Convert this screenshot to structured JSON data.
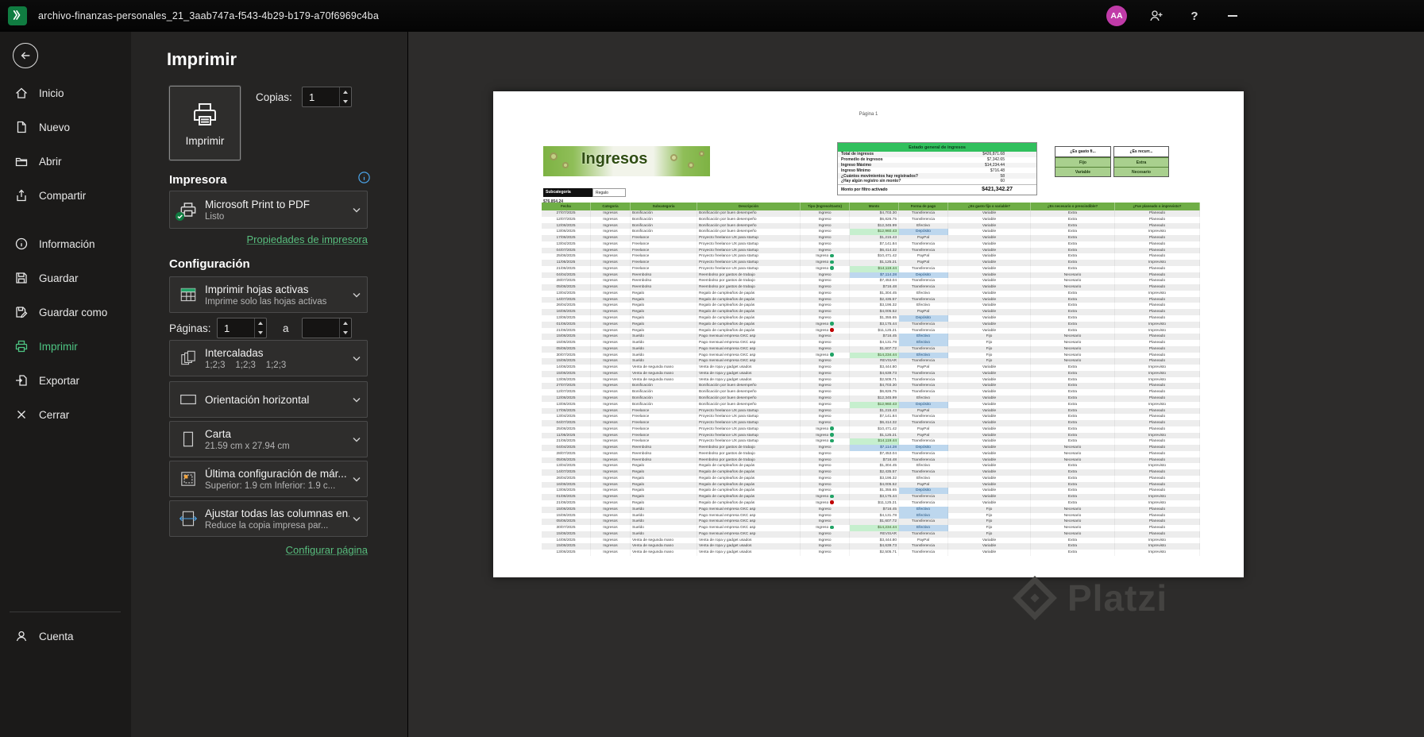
{
  "titlebar": {
    "title": "archivo-finanzas-personales_21_3aab747a-f543-4b29-b179-a70f6969c4ba",
    "avatar_initials": "AA"
  },
  "sidebar": {
    "items": [
      {
        "label": "Inicio"
      },
      {
        "label": "Nuevo"
      },
      {
        "label": "Abrir"
      },
      {
        "label": "Compartir"
      },
      {
        "label": "Información"
      },
      {
        "label": "Guardar"
      },
      {
        "label": "Guardar como"
      },
      {
        "label": "Imprimir",
        "active": true
      },
      {
        "label": "Exportar"
      },
      {
        "label": "Cerrar"
      },
      {
        "label": "Cuenta"
      }
    ]
  },
  "print_panel": {
    "title": "Imprimir",
    "print_button_label": "Imprimir",
    "copies_label": "Copias:",
    "copies_value": "1",
    "printer_section": "Impresora",
    "printer_name": "Microsoft Print to PDF",
    "printer_status": "Listo",
    "printer_props_link": "Propiedades de impresora",
    "settings_section": "Configuración",
    "pages_label": "Páginas:",
    "pages_from": "1",
    "pages_sep": "a",
    "pages_to": "",
    "dropdowns": [
      {
        "title": "Imprimir hojas activas",
        "subtitle": "Imprime solo las hojas activas"
      },
      {
        "title": "Intercaladas",
        "subtitle": "1;2;3    1;2;3    1;2;3"
      },
      {
        "title": "Orientación horizontal",
        "subtitle": ""
      },
      {
        "title": "Carta",
        "subtitle": "21.59 cm x 27.94 cm"
      },
      {
        "title": "Última configuración de már...",
        "subtitle": "Superior: 1.9 cm Inferior: 1.9 c..."
      },
      {
        "title": "Ajustar todas las columnas en...",
        "subtitle": "Reduce la copia impresa par..."
      }
    ],
    "page_setup_link": "Configurar página"
  },
  "preview": {
    "page_header": "Página 1",
    "banner_title": "Ingresos",
    "filter_label": "Subcategoría",
    "filter_value": "Regalo",
    "filter_amount": "$76,854.24",
    "summary": {
      "title": "Estado general de ingresos",
      "rows": [
        [
          "Total de ingresos",
          "$426,871.68"
        ],
        [
          "Promedio de ingresos",
          "$7,342.65"
        ],
        [
          "Ingreso Máximo",
          "$14,234.44"
        ],
        [
          "Ingreso Mínimo",
          "$716.48"
        ],
        [
          "¿Cuántos movimientos hay registrados?",
          "58"
        ],
        [
          "¿Hay algún registro sin monto?",
          "60"
        ]
      ],
      "total_label": "Monto por filtro activado",
      "total_value": "$421,342.27"
    },
    "mini_tables": [
      {
        "header": "¿Es gasto fi...",
        "rows": [
          "Fijo",
          "Variable"
        ]
      },
      {
        "header": "¿Es recurr...",
        "rows": [
          "Extra",
          "Necesario"
        ]
      }
    ],
    "table": {
      "headers": [
        "Fecha",
        "Categoría",
        "Subcategoría",
        "Descripción",
        "Tipo (Ingreso/Gasto)",
        "Monto",
        "Forma de pago",
        "¿Es gasto fijo o variable?",
        "¿Es necesario o prescindible?",
        "¿Fue planeado o imprevisto?"
      ],
      "categoria": "Ingresos",
      "tipo": "Ingreso",
      "subcat_desc": {
        "Bonificación": "Bonificación por buen desempeño",
        "Freelance": "Proyecto freelance UX para startup",
        "Reembolso": "Reembolso por gastos de trabajo",
        "Regalo": "Regalo de cumpleaños de papás",
        "Sueldo": "Pago mensual empresa GKC asp",
        "Venta de segunda mano": "Venta de ropa y gadget usados"
      },
      "rows": [
        [
          "27/07/2025",
          "Bonificación",
          "$4,703.30",
          "",
          "Transferencia",
          "",
          "Variable",
          "Extra",
          "Planeado",
          ""
        ],
        [
          "12/07/2025",
          "Bonificación",
          "$6,826.75",
          "",
          "Transferencia",
          "",
          "Variable",
          "Extra",
          "Planeado",
          ""
        ],
        [
          "12/06/2025",
          "Bonificación",
          "$12,345.99",
          "",
          "Efectivo",
          "",
          "Variable",
          "Extra",
          "Planeado",
          ""
        ],
        [
          "13/06/2025",
          "Bonificación",
          "$12,960.43",
          "green",
          "Depósito",
          "blue",
          "Variable",
          "Extra",
          "Imprevisto",
          ""
        ],
        [
          "17/06/2025",
          "Freelance",
          "$1,215.43",
          "",
          "PayPal",
          "",
          "Variable",
          "Extra",
          "Planeado",
          ""
        ],
        [
          "13/04/2025",
          "Freelance",
          "$7,141.84",
          "",
          "Transferencia",
          "",
          "Variable",
          "Extra",
          "Planeado",
          ""
        ],
        [
          "04/07/2025",
          "Freelance",
          "$6,414.32",
          "",
          "Transferencia",
          "",
          "Variable",
          "Extra",
          "Planeado",
          ""
        ],
        [
          "25/06/2025",
          "Freelance",
          "$10,471.42",
          "",
          "PayPal",
          "",
          "Variable",
          "Extra",
          "Planeado",
          "check"
        ],
        [
          "11/06/2025",
          "Freelance",
          "$1,125.21",
          "",
          "PayPal",
          "",
          "Variable",
          "Extra",
          "Imprevisto",
          "check"
        ],
        [
          "21/06/2025",
          "Freelance",
          "$14,119.44",
          "green",
          "Transferencia",
          "",
          "Variable",
          "Extra",
          "Planeado",
          "check"
        ],
        [
          "04/04/2025",
          "Reembolso",
          "$7,114.28",
          "blue",
          "Depósito",
          "blue",
          "Variable",
          "Necesario",
          "Planeado",
          ""
        ],
        [
          "28/07/2025",
          "Reembolso",
          "$7,453.04",
          "",
          "Transferencia",
          "",
          "Variable",
          "Necesario",
          "Planeado",
          ""
        ],
        [
          "05/06/2025",
          "Reembolso",
          "$716.48",
          "",
          "Transferencia",
          "",
          "Variable",
          "Necesario",
          "Planeado",
          ""
        ],
        [
          "13/04/2025",
          "Regalo",
          "$1,304.45",
          "",
          "Efectivo",
          "",
          "Variable",
          "Extra",
          "Imprevisto",
          ""
        ],
        [
          "14/07/2025",
          "Regalo",
          "$2,435.57",
          "",
          "Transferencia",
          "",
          "Variable",
          "Extra",
          "Planeado",
          ""
        ],
        [
          "26/04/2025",
          "Regalo",
          "$3,196.32",
          "",
          "Efectivo",
          "",
          "Variable",
          "Extra",
          "Planeado",
          ""
        ],
        [
          "16/06/2025",
          "Regalo",
          "$4,005.52",
          "",
          "PayPal",
          "",
          "Variable",
          "Extra",
          "Planeado",
          ""
        ],
        [
          "13/06/2025",
          "Regalo",
          "$1,355.65",
          "",
          "Depósito",
          "blue",
          "Variable",
          "Extra",
          "Planeado",
          ""
        ],
        [
          "01/06/2025",
          "Regalo",
          "$3,175.44",
          "",
          "Transferencia",
          "",
          "Variable",
          "Extra",
          "Imprevisto",
          "check"
        ],
        [
          "21/06/2025",
          "Regalo",
          "$11,125.21",
          "",
          "Transferencia",
          "",
          "Variable",
          "Extra",
          "Imprevisto",
          "red"
        ],
        [
          "15/06/2025",
          "Sueldo",
          "$716.45",
          "",
          "Efectivo",
          "blue",
          "Fijo",
          "Necesario",
          "Planeado",
          ""
        ],
        [
          "15/06/2025",
          "Sueldo",
          "$4,131.78",
          "",
          "Efectivo",
          "blue",
          "Fijo",
          "Necesario",
          "Planeado",
          ""
        ],
        [
          "05/06/2025",
          "Sueldo",
          "$1,607.72",
          "",
          "Transferencia",
          "",
          "Fijo",
          "Necesario",
          "Planeado",
          ""
        ],
        [
          "30/07/2025",
          "Sueldo",
          "$14,234.44",
          "green",
          "Efectivo",
          "blue",
          "Fijo",
          "Necesario",
          "Planeado",
          "check"
        ],
        [
          "15/06/2025",
          "Sueldo",
          "REVISAR",
          "",
          "Transferencia",
          "",
          "Fijo",
          "Necesario",
          "Planeado",
          ""
        ],
        [
          "14/06/2025",
          "Venta de segunda mano",
          "$3,444.80",
          "",
          "PayPal",
          "",
          "Variable",
          "Extra",
          "Imprevisto",
          ""
        ],
        [
          "15/06/2025",
          "Venta de segunda mano",
          "$4,639.73",
          "",
          "Transferencia",
          "",
          "Variable",
          "Extra",
          "Imprevisto",
          ""
        ],
        [
          "13/06/2025",
          "Venta de segunda mano",
          "$2,505.71",
          "",
          "Transferencia",
          "",
          "Variable",
          "Extra",
          "Imprevisto",
          ""
        ],
        [
          "27/07/2025",
          "Bonificación",
          "$4,703.30",
          "",
          "Transferencia",
          "",
          "Variable",
          "Extra",
          "Planeado",
          ""
        ],
        [
          "12/07/2025",
          "Bonificación",
          "$6,826.75",
          "",
          "Transferencia",
          "",
          "Variable",
          "Extra",
          "Planeado",
          ""
        ],
        [
          "12/06/2025",
          "Bonificación",
          "$12,345.99",
          "",
          "Efectivo",
          "",
          "Variable",
          "Extra",
          "Planeado",
          ""
        ],
        [
          "13/06/2025",
          "Bonificación",
          "$12,960.43",
          "green",
          "Depósito",
          "blue",
          "Variable",
          "Extra",
          "Imprevisto",
          ""
        ],
        [
          "17/06/2025",
          "Freelance",
          "$1,215.43",
          "",
          "PayPal",
          "",
          "Variable",
          "Extra",
          "Planeado",
          ""
        ],
        [
          "13/04/2025",
          "Freelance",
          "$7,141.84",
          "",
          "Transferencia",
          "",
          "Variable",
          "Extra",
          "Planeado",
          ""
        ],
        [
          "04/07/2025",
          "Freelance",
          "$6,414.32",
          "",
          "Transferencia",
          "",
          "Variable",
          "Extra",
          "Planeado",
          ""
        ],
        [
          "25/06/2025",
          "Freelance",
          "$10,471.42",
          "",
          "PayPal",
          "",
          "Variable",
          "Extra",
          "Planeado",
          "check"
        ],
        [
          "11/06/2025",
          "Freelance",
          "$1,125.21",
          "",
          "PayPal",
          "",
          "Variable",
          "Extra",
          "Imprevisto",
          "check"
        ],
        [
          "21/06/2025",
          "Freelance",
          "$14,119.44",
          "green",
          "Transferencia",
          "",
          "Variable",
          "Extra",
          "Planeado",
          "check"
        ],
        [
          "04/04/2025",
          "Reembolso",
          "$7,114.28",
          "blue",
          "Depósito",
          "blue",
          "Variable",
          "Necesario",
          "Planeado",
          ""
        ],
        [
          "28/07/2025",
          "Reembolso",
          "$7,453.04",
          "",
          "Transferencia",
          "",
          "Variable",
          "Necesario",
          "Planeado",
          ""
        ],
        [
          "05/06/2025",
          "Reembolso",
          "$716.48",
          "",
          "Transferencia",
          "",
          "Variable",
          "Necesario",
          "Planeado",
          ""
        ],
        [
          "13/04/2025",
          "Regalo",
          "$1,304.45",
          "",
          "Efectivo",
          "",
          "Variable",
          "Extra",
          "Imprevisto",
          ""
        ],
        [
          "14/07/2025",
          "Regalo",
          "$2,435.57",
          "",
          "Transferencia",
          "",
          "Variable",
          "Extra",
          "Planeado",
          ""
        ],
        [
          "26/04/2025",
          "Regalo",
          "$3,196.32",
          "",
          "Efectivo",
          "",
          "Variable",
          "Extra",
          "Planeado",
          ""
        ],
        [
          "16/06/2025",
          "Regalo",
          "$4,005.52",
          "",
          "PayPal",
          "",
          "Variable",
          "Extra",
          "Planeado",
          ""
        ],
        [
          "13/06/2025",
          "Regalo",
          "$1,355.65",
          "",
          "Depósito",
          "blue",
          "Variable",
          "Extra",
          "Planeado",
          ""
        ],
        [
          "01/06/2025",
          "Regalo",
          "$3,175.44",
          "",
          "Transferencia",
          "",
          "Variable",
          "Extra",
          "Imprevisto",
          "check"
        ],
        [
          "21/06/2025",
          "Regalo",
          "$11,125.21",
          "",
          "Transferencia",
          "",
          "Variable",
          "Extra",
          "Imprevisto",
          "red"
        ],
        [
          "15/06/2025",
          "Sueldo",
          "$716.45",
          "",
          "Efectivo",
          "blue",
          "Fijo",
          "Necesario",
          "Planeado",
          ""
        ],
        [
          "15/06/2025",
          "Sueldo",
          "$4,131.78",
          "",
          "Efectivo",
          "blue",
          "Fijo",
          "Necesario",
          "Planeado",
          ""
        ],
        [
          "05/06/2025",
          "Sueldo",
          "$1,607.72",
          "",
          "Transferencia",
          "",
          "Fijo",
          "Necesario",
          "Planeado",
          ""
        ],
        [
          "30/07/2025",
          "Sueldo",
          "$14,234.44",
          "green",
          "Efectivo",
          "blue",
          "Fijo",
          "Necesario",
          "Planeado",
          "check"
        ],
        [
          "15/06/2025",
          "Sueldo",
          "REVISAR",
          "",
          "Transferencia",
          "",
          "Fijo",
          "Necesario",
          "Planeado",
          ""
        ],
        [
          "14/06/2025",
          "Venta de segunda mano",
          "$3,444.80",
          "",
          "PayPal",
          "",
          "Variable",
          "Extra",
          "Imprevisto",
          ""
        ],
        [
          "15/06/2025",
          "Venta de segunda mano",
          "$4,639.73",
          "",
          "Transferencia",
          "",
          "Variable",
          "Extra",
          "Imprevisto",
          ""
        ],
        [
          "13/06/2025",
          "Venta de segunda mano",
          "$2,505.71",
          "",
          "Transferencia",
          "",
          "Variable",
          "Extra",
          "Imprevisto",
          ""
        ]
      ]
    }
  },
  "watermark": "Platzi",
  "colors": {
    "accent_green": "#21A366",
    "link_green": "#58BE7E",
    "table_header_green": "#6FAE46",
    "summary_header_green": "#31C05D",
    "mini_row_green": "#A9D08E",
    "highlight_green": "#C6EFCE",
    "highlight_blue": "#BDD7EE",
    "avatar_magenta": "#C03BA8"
  }
}
